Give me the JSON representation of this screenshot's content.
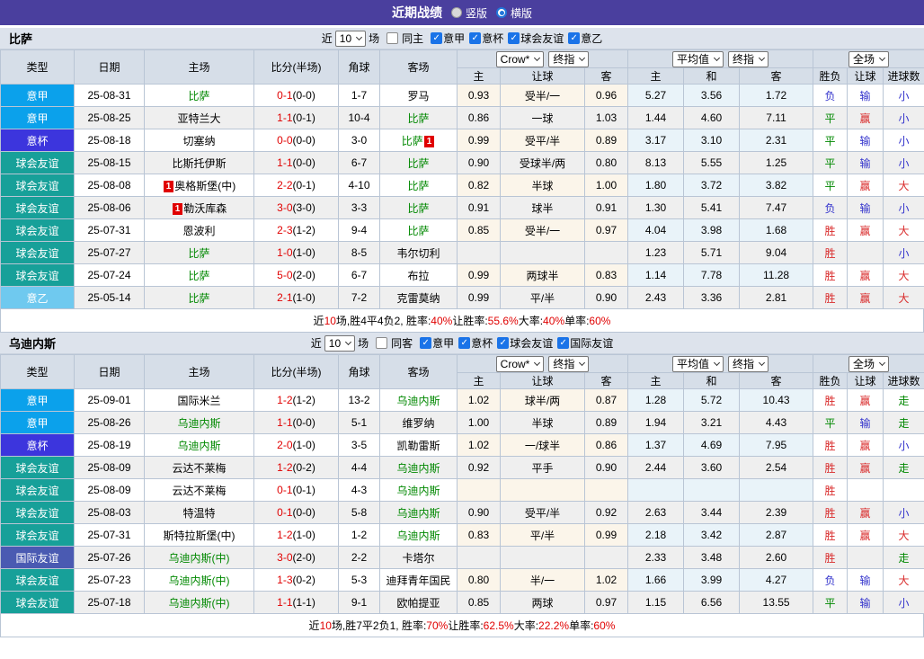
{
  "title_bar": {
    "title": "近期战绩",
    "vertical_label": "竖版",
    "horizontal_label": "横版",
    "vertical_selected": false,
    "horizontal_selected": true
  },
  "columns": {
    "type": "类型",
    "date": "日期",
    "home": "主场",
    "score": "比分(半场)",
    "corner": "角球",
    "away": "客场",
    "odds_home": "主",
    "handicap": "让球",
    "odds_away": "客",
    "avg_home": "主",
    "avg_draw": "和",
    "avg_away": "客",
    "result_wdl": "胜负",
    "result_handicap": "让球",
    "result_goals": "进球数"
  },
  "dropdowns": {
    "company": "Crow*",
    "company_time": "终指",
    "average": "平均值",
    "average_time": "终指",
    "scope": "全场"
  },
  "colors": {
    "top_bar": "#4a3f9e",
    "score_red": "#e00000",
    "team_green": "#008800",
    "result_red": "#d92b2b",
    "result_green": "#008800",
    "result_blue": "#3333cc",
    "badge_bg": "#e00000"
  },
  "league_colors": {
    "意甲": "#0ba1eb",
    "意杯": "#3c35dd",
    "球会友谊": "#17a099",
    "意乙": "#6fc9ef",
    "国际友谊": "#4a5ab2"
  },
  "result_word_colors": {
    "胜": "red",
    "平": "green",
    "负": "blue",
    "赢": "red",
    "输": "blue",
    "大": "red",
    "小": "blue",
    "走": "green"
  },
  "sections": [
    {
      "team": "比萨",
      "filter": {
        "near": "近",
        "count": "10",
        "games": "场",
        "same": "同主",
        "same_checked": false,
        "leagues": [
          {
            "label": "意甲",
            "checked": true
          },
          {
            "label": "意杯",
            "checked": true
          },
          {
            "label": "球会友谊",
            "checked": true
          },
          {
            "label": "意乙",
            "checked": true
          }
        ]
      },
      "rows": [
        {
          "type": "意甲",
          "date": "25-08-31",
          "home": {
            "name": "比萨",
            "green": true
          },
          "score": "0-1",
          "half": "(0-0)",
          "corner": "1-7",
          "away": {
            "name": "罗马"
          },
          "odds": [
            "0.93",
            "受半/一",
            "0.96"
          ],
          "avg": [
            "5.27",
            "3.56",
            "1.72"
          ],
          "res": [
            "负",
            "输",
            "小"
          ]
        },
        {
          "type": "意甲",
          "date": "25-08-25",
          "home": {
            "name": "亚特兰大"
          },
          "score": "1-1",
          "half": "(0-1)",
          "corner": "10-4",
          "away": {
            "name": "比萨",
            "green": true
          },
          "odds": [
            "0.86",
            "一球",
            "1.03"
          ],
          "avg": [
            "1.44",
            "4.60",
            "7.11"
          ],
          "res": [
            "平",
            "赢",
            "小"
          ]
        },
        {
          "type": "意杯",
          "date": "25-08-18",
          "home": {
            "name": "切塞纳"
          },
          "score": "0-0",
          "half": "(0-0)",
          "corner": "3-0",
          "away": {
            "name": "比萨",
            "green": true,
            "badge": "1",
            "badge_pos": "after"
          },
          "odds": [
            "0.99",
            "受平/半",
            "0.89"
          ],
          "avg": [
            "3.17",
            "3.10",
            "2.31"
          ],
          "res": [
            "平",
            "输",
            "小"
          ]
        },
        {
          "type": "球会友谊",
          "date": "25-08-15",
          "home": {
            "name": "比斯托伊斯"
          },
          "score": "1-1",
          "half": "(0-0)",
          "corner": "6-7",
          "away": {
            "name": "比萨",
            "green": true
          },
          "odds": [
            "0.90",
            "受球半/两",
            "0.80"
          ],
          "avg": [
            "8.13",
            "5.55",
            "1.25"
          ],
          "res": [
            "平",
            "输",
            "小"
          ]
        },
        {
          "type": "球会友谊",
          "date": "25-08-08",
          "home": {
            "name": "奥格斯堡(中)",
            "badge": "1",
            "badge_pos": "before"
          },
          "score": "2-2",
          "half": "(0-1)",
          "corner": "4-10",
          "away": {
            "name": "比萨",
            "green": true
          },
          "odds": [
            "0.82",
            "半球",
            "1.00"
          ],
          "avg": [
            "1.80",
            "3.72",
            "3.82"
          ],
          "res": [
            "平",
            "赢",
            "大"
          ]
        },
        {
          "type": "球会友谊",
          "date": "25-08-06",
          "home": {
            "name": "勒沃库森",
            "badge": "1",
            "badge_pos": "before"
          },
          "score": "3-0",
          "half": "(3-0)",
          "corner": "3-3",
          "away": {
            "name": "比萨",
            "green": true
          },
          "odds": [
            "0.91",
            "球半",
            "0.91"
          ],
          "avg": [
            "1.30",
            "5.41",
            "7.47"
          ],
          "res": [
            "负",
            "输",
            "小"
          ]
        },
        {
          "type": "球会友谊",
          "date": "25-07-31",
          "home": {
            "name": "恩波利"
          },
          "score": "2-3",
          "half": "(1-2)",
          "corner": "9-4",
          "away": {
            "name": "比萨",
            "green": true
          },
          "odds": [
            "0.85",
            "受半/一",
            "0.97"
          ],
          "avg": [
            "4.04",
            "3.98",
            "1.68"
          ],
          "res": [
            "胜",
            "赢",
            "大"
          ]
        },
        {
          "type": "球会友谊",
          "date": "25-07-27",
          "home": {
            "name": "比萨",
            "green": true
          },
          "score": "1-0",
          "half": "(1-0)",
          "corner": "8-5",
          "away": {
            "name": "韦尔切利"
          },
          "odds": [
            "",
            "",
            ""
          ],
          "avg": [
            "1.23",
            "5.71",
            "9.04"
          ],
          "res": [
            "胜",
            "",
            "小"
          ]
        },
        {
          "type": "球会友谊",
          "date": "25-07-24",
          "home": {
            "name": "比萨",
            "green": true
          },
          "score": "5-0",
          "half": "(2-0)",
          "corner": "6-7",
          "away": {
            "name": "布拉"
          },
          "odds": [
            "0.99",
            "两球半",
            "0.83"
          ],
          "avg": [
            "1.14",
            "7.78",
            "11.28"
          ],
          "res": [
            "胜",
            "赢",
            "大"
          ]
        },
        {
          "type": "意乙",
          "date": "25-05-14",
          "home": {
            "name": "比萨",
            "green": true
          },
          "score": "2-1",
          "half": "(1-0)",
          "corner": "7-2",
          "away": {
            "name": "克雷莫纳"
          },
          "odds": [
            "0.99",
            "平/半",
            "0.90"
          ],
          "avg": [
            "2.43",
            "3.36",
            "2.81"
          ],
          "res": [
            "胜",
            "赢",
            "大"
          ]
        }
      ],
      "summary": [
        {
          "text": "近",
          "red": false
        },
        {
          "text": "10",
          "red": true
        },
        {
          "text": "场,胜4平4负2, 胜率:",
          "red": false
        },
        {
          "text": "40%",
          "red": true
        },
        {
          "text": " 让胜率:",
          "red": false
        },
        {
          "text": "55.6%",
          "red": true
        },
        {
          "text": " 大率:",
          "red": false
        },
        {
          "text": "40%",
          "red": true
        },
        {
          "text": " 单率:",
          "red": false
        },
        {
          "text": "60%",
          "red": true
        }
      ]
    },
    {
      "team": "乌迪内斯",
      "filter": {
        "near": "近",
        "count": "10",
        "games": "场",
        "same": "同客",
        "same_checked": false,
        "leagues": [
          {
            "label": "意甲",
            "checked": true
          },
          {
            "label": "意杯",
            "checked": true
          },
          {
            "label": "球会友谊",
            "checked": true
          },
          {
            "label": "国际友谊",
            "checked": true
          }
        ]
      },
      "rows": [
        {
          "type": "意甲",
          "date": "25-09-01",
          "home": {
            "name": "国际米兰"
          },
          "score": "1-2",
          "half": "(1-2)",
          "corner": "13-2",
          "away": {
            "name": "乌迪内斯",
            "green": true
          },
          "odds": [
            "1.02",
            "球半/两",
            "0.87"
          ],
          "avg": [
            "1.28",
            "5.72",
            "10.43"
          ],
          "res": [
            "胜",
            "赢",
            "走"
          ]
        },
        {
          "type": "意甲",
          "date": "25-08-26",
          "home": {
            "name": "乌迪内斯",
            "green": true
          },
          "score": "1-1",
          "half": "(0-0)",
          "corner": "5-1",
          "away": {
            "name": "维罗纳"
          },
          "odds": [
            "1.00",
            "半球",
            "0.89"
          ],
          "avg": [
            "1.94",
            "3.21",
            "4.43"
          ],
          "res": [
            "平",
            "输",
            "走"
          ]
        },
        {
          "type": "意杯",
          "date": "25-08-19",
          "home": {
            "name": "乌迪内斯",
            "green": true
          },
          "score": "2-0",
          "half": "(1-0)",
          "corner": "3-5",
          "away": {
            "name": "凯勒雷斯"
          },
          "odds": [
            "1.02",
            "一/球半",
            "0.86"
          ],
          "avg": [
            "1.37",
            "4.69",
            "7.95"
          ],
          "res": [
            "胜",
            "赢",
            "小"
          ]
        },
        {
          "type": "球会友谊",
          "date": "25-08-09",
          "home": {
            "name": "云达不莱梅"
          },
          "score": "1-2",
          "half": "(0-2)",
          "corner": "4-4",
          "away": {
            "name": "乌迪内斯",
            "green": true
          },
          "odds": [
            "0.92",
            "平手",
            "0.90"
          ],
          "avg": [
            "2.44",
            "3.60",
            "2.54"
          ],
          "res": [
            "胜",
            "赢",
            "走"
          ]
        },
        {
          "type": "球会友谊",
          "date": "25-08-09",
          "home": {
            "name": "云达不莱梅"
          },
          "score": "0-1",
          "half": "(0-1)",
          "corner": "4-3",
          "away": {
            "name": "乌迪内斯",
            "green": true
          },
          "odds": [
            "",
            "",
            ""
          ],
          "avg": [
            "",
            "",
            ""
          ],
          "res": [
            "胜",
            "",
            ""
          ]
        },
        {
          "type": "球会友谊",
          "date": "25-08-03",
          "home": {
            "name": "特温特"
          },
          "score": "0-1",
          "half": "(0-0)",
          "corner": "5-8",
          "away": {
            "name": "乌迪内斯",
            "green": true
          },
          "odds": [
            "0.90",
            "受平/半",
            "0.92"
          ],
          "avg": [
            "2.63",
            "3.44",
            "2.39"
          ],
          "res": [
            "胜",
            "赢",
            "小"
          ]
        },
        {
          "type": "球会友谊",
          "date": "25-07-31",
          "home": {
            "name": "斯特拉斯堡(中)"
          },
          "score": "1-2",
          "half": "(1-0)",
          "corner": "1-2",
          "away": {
            "name": "乌迪内斯",
            "green": true
          },
          "odds": [
            "0.83",
            "平/半",
            "0.99"
          ],
          "avg": [
            "2.18",
            "3.42",
            "2.87"
          ],
          "res": [
            "胜",
            "赢",
            "大"
          ]
        },
        {
          "type": "国际友谊",
          "date": "25-07-26",
          "home": {
            "name": "乌迪内斯(中)",
            "green": true
          },
          "score": "3-0",
          "half": "(2-0)",
          "corner": "2-2",
          "away": {
            "name": "卡塔尔"
          },
          "odds": [
            "",
            "",
            ""
          ],
          "avg": [
            "2.33",
            "3.48",
            "2.60"
          ],
          "res": [
            "胜",
            "",
            "走"
          ]
        },
        {
          "type": "球会友谊",
          "date": "25-07-23",
          "home": {
            "name": "乌迪内斯(中)",
            "green": true
          },
          "score": "1-3",
          "half": "(0-2)",
          "corner": "5-3",
          "away": {
            "name": "迪拜青年国民"
          },
          "odds": [
            "0.80",
            "半/一",
            "1.02"
          ],
          "avg": [
            "1.66",
            "3.99",
            "4.27"
          ],
          "res": [
            "负",
            "输",
            "大"
          ]
        },
        {
          "type": "球会友谊",
          "date": "25-07-18",
          "home": {
            "name": "乌迪内斯(中)",
            "green": true
          },
          "score": "1-1",
          "half": "(1-1)",
          "corner": "9-1",
          "away": {
            "name": "欧帕提亚"
          },
          "odds": [
            "0.85",
            "两球",
            "0.97"
          ],
          "avg": [
            "1.15",
            "6.56",
            "13.55"
          ],
          "res": [
            "平",
            "输",
            "小"
          ]
        }
      ],
      "summary": [
        {
          "text": "近",
          "red": false
        },
        {
          "text": "10",
          "red": true
        },
        {
          "text": "场,胜7平2负1, 胜率:",
          "red": false
        },
        {
          "text": "70%",
          "red": true
        },
        {
          "text": " 让胜率:",
          "red": false
        },
        {
          "text": "62.5%",
          "red": true
        },
        {
          "text": " 大率:",
          "red": false
        },
        {
          "text": "22.2%",
          "red": true
        },
        {
          "text": " 单率:",
          "red": false
        },
        {
          "text": "60%",
          "red": true
        }
      ]
    }
  ]
}
